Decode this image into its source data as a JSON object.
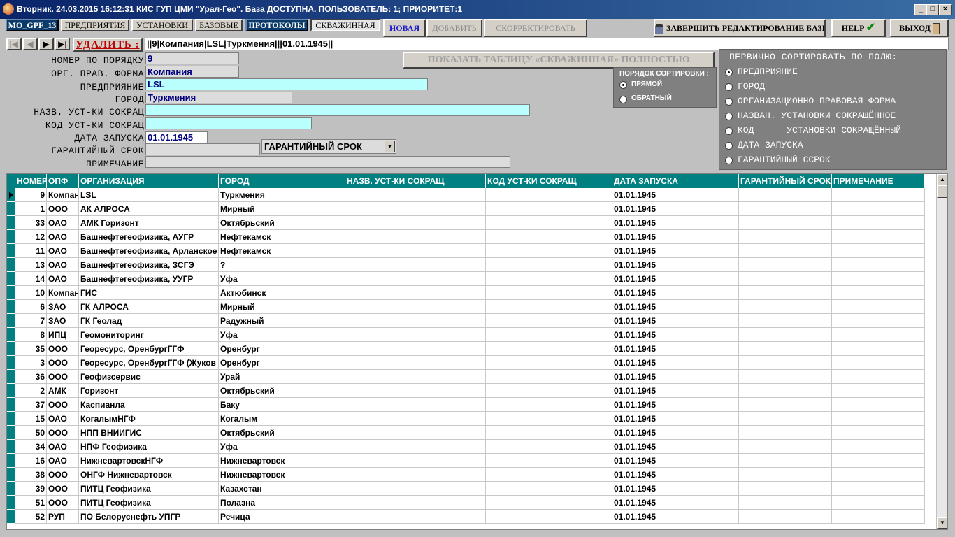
{
  "window": {
    "title": "Вторник. 24.03.2015 16:12:31 КИС ГУП ЦМИ \"Урал-Гео\". База ДОСТУПНА. ПОЛЬЗОВАТЕЛЬ: 1; ПРИОРИТЕТ:1"
  },
  "toolbar": {
    "db_label": "MO_GPF_13",
    "tabs": [
      "ПРЕДПРИЯТИЯ",
      "УСТАНОВКИ",
      "БАЗОВЫЕ",
      "ПРОТОКОЛЫ",
      "СКВАЖИННАЯ"
    ],
    "new_label": "НОВАЯ",
    "add_label": "ДОБАВИТЬ",
    "edit_label": "СКОРРЕКТИРОВАТЬ",
    "finish_label": "ЗАВЕРШИТЬ РЕДАКТИРОВАНИЕ БАЗЫ",
    "help_label": "HELP",
    "exit_label": "ВЫХОД"
  },
  "nav": {
    "delete_label": "УДАЛИТЬ :",
    "record_string": "||9|Компания|LSL|Туркмения|||01.01.1945||"
  },
  "form": {
    "labels": {
      "number": "НОМЕР ПО ПОРЯДКУ",
      "org_form": "ОРГ. ПРАВ. ФОРМА",
      "enterprise": "ПРЕДПРИЯНИЕ",
      "city": "ГОРОД",
      "install_name": "НАЗВ. УСТ-КИ СОКРАЩ",
      "install_code": "КОД  УСТ-КИ СОКРАЩ",
      "launch_date": "ДАТА ЗАПУСКА",
      "warranty": "ГАРАНТИЙНЫЙ СРОК",
      "note": "ПРИМЕЧАНИЕ"
    },
    "values": {
      "number": "9",
      "org_form": "Компания",
      "enterprise": "LSL",
      "city": "Туркмения",
      "install_name": "",
      "install_code": "",
      "launch_date": "01.01.1945",
      "warranty": "",
      "note": ""
    },
    "warranty_select": "ГАРАНТИЙНЫЙ СРОК",
    "show_table_label": "ПОКАЗАТЬ ТАБЛИЦУ «СКВАЖИННАЯ» ПОЛНОСТЬЮ"
  },
  "sort_order": {
    "title": "ПОРЯДОК СОРТИРОВКИ :",
    "options": [
      "ПРЯМОЙ",
      "ОБРАТНЫЙ"
    ],
    "selected": 0
  },
  "primary_sort": {
    "title": "ПЕРВИЧНО СОРТИРОВАТЬ ПО ПОЛЮ:",
    "options": [
      "ПРЕДПРИЯНИЕ",
      "ГОРОД",
      "ОРГАНИЗАЦИОННО-ПРАВОВАЯ ФОРМА",
      "НАЗВАН. УСТАНОВКИ СОКРАЩЁННОЕ",
      "КОД      УСТАНОВКИ СОКРАЩЁННЫЙ",
      "ДАТА ЗАПУСКА",
      "ГАРАНТИЙНЫЙ ССРОК"
    ],
    "selected": 0
  },
  "table": {
    "columns": [
      "НОМЕР",
      "ОПФ",
      "ОРГАНИЗАЦИЯ",
      "ГОРОД",
      "НАЗВ. УСТ-КИ СОКРАЩ",
      "КОД УСТ-КИ СОКРАЩ",
      "ДАТА ЗАПУСКА",
      "ГАРАНТИЙНЫЙ СРОК",
      "ПРИМЕЧАНИЕ"
    ],
    "rows": [
      [
        "9",
        "Компания",
        "LSL",
        "Туркмения",
        "",
        "",
        "01.01.1945",
        "",
        ""
      ],
      [
        "1",
        "ООО",
        "АК АЛРОСА",
        "Мирный",
        "",
        "",
        "01.01.1945",
        "",
        ""
      ],
      [
        "33",
        "ОАО",
        "АМК Горизонт",
        "Октябрьский",
        "",
        "",
        "01.01.1945",
        "",
        ""
      ],
      [
        "12",
        "ОАО",
        "Башнефтегеофизика, АУГР",
        "Нефтекамск",
        "",
        "",
        "01.01.1945",
        "",
        ""
      ],
      [
        "11",
        "ОАО",
        "Башнефтегеофизика, Арланское УГР",
        "Нефтекамск",
        "",
        "",
        "01.01.1945",
        "",
        ""
      ],
      [
        "13",
        "ОАО",
        "Башнефтегеофизика, ЗСГЭ",
        "?",
        "",
        "",
        "01.01.1945",
        "",
        ""
      ],
      [
        "14",
        "ОАО",
        "Башнефтегеофизика, УУГР",
        "Уфа",
        "",
        "",
        "01.01.1945",
        "",
        ""
      ],
      [
        "10",
        "Компания",
        "ГИС",
        "Актюбинск",
        "",
        "",
        "01.01.1945",
        "",
        ""
      ],
      [
        "6",
        "ЗАО",
        "ГК АЛРОСА",
        "Мирный",
        "",
        "",
        "01.01.1945",
        "",
        ""
      ],
      [
        "7",
        "ЗАО",
        "ГК Геолад",
        "Радужный",
        "",
        "",
        "01.01.1945",
        "",
        ""
      ],
      [
        "8",
        "ИПЦ",
        "Геомониторинг",
        "Уфа",
        "",
        "",
        "01.01.1945",
        "",
        ""
      ],
      [
        "35",
        "ООО",
        "Георесурс, ОренбургГГФ",
        "Оренбург",
        "",
        "",
        "01.01.1945",
        "",
        ""
      ],
      [
        "3",
        "ООО",
        "Георесурс, ОренбургГГФ (Жуков Н",
        "Оренбург",
        "",
        "",
        "01.01.1945",
        "",
        ""
      ],
      [
        "36",
        "ООО",
        "Геофизсервис",
        "Урай",
        "",
        "",
        "01.01.1945",
        "",
        ""
      ],
      [
        "2",
        "АМК",
        "Горизонт",
        "Октябрьский",
        "",
        "",
        "01.01.1945",
        "",
        ""
      ],
      [
        "37",
        "ООО",
        "Каспианла",
        "Баку",
        "",
        "",
        "01.01.1945",
        "",
        ""
      ],
      [
        "15",
        "ОАО",
        "КогалымНГФ",
        "Когалым",
        "",
        "",
        "01.01.1945",
        "",
        ""
      ],
      [
        "50",
        "ООО",
        "НПП ВНИИГИС",
        "Октябрьский",
        "",
        "",
        "01.01.1945",
        "",
        ""
      ],
      [
        "34",
        "ОАО",
        "НПФ Геофизика",
        "Уфа",
        "",
        "",
        "01.01.1945",
        "",
        ""
      ],
      [
        "16",
        "ОАО",
        "НижневартовскНГФ",
        "Нижневартовск",
        "",
        "",
        "01.01.1945",
        "",
        ""
      ],
      [
        "38",
        "ООО",
        "ОНГФ Нижневартовск",
        "Нижневартовск",
        "",
        "",
        "01.01.1945",
        "",
        ""
      ],
      [
        "39",
        "ООО",
        "ПИТЦ Геофизика",
        "Казахстан",
        "",
        "",
        "01.01.1945",
        "",
        ""
      ],
      [
        "51",
        "ООО",
        "ПИТЦ Геофизика",
        "Полазна",
        "",
        "",
        "01.01.1945",
        "",
        ""
      ],
      [
        "52",
        "РУП",
        "ПО Белоруснефть УПГР",
        "Речица",
        "",
        "",
        "01.01.1945",
        "",
        ""
      ]
    ]
  },
  "colors": {
    "header": "#008080",
    "field_cyan": "#b8fffe",
    "title_dark": "#0a246a"
  }
}
